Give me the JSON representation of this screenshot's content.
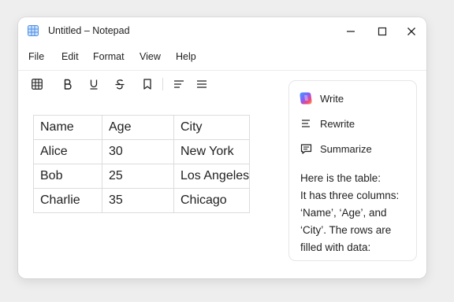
{
  "window": {
    "title": "Untitled – Notepad",
    "app_icon": "table-grid-icon",
    "controls": [
      "minimize-icon",
      "maximize-icon",
      "close-icon"
    ]
  },
  "menu": [
    "File",
    "Edit",
    "Format",
    "View",
    "Help"
  ],
  "toolbar": {
    "buttons": [
      "table-icon",
      "bold-icon",
      "underline-icon",
      "strikethrough-icon",
      "bookmark-icon",
      "align-left-icon",
      "list-icon"
    ]
  },
  "table": {
    "rows": [
      [
        "Name",
        "Age",
        "City"
      ],
      [
        "Alice",
        "30",
        "New York"
      ],
      [
        "Bob",
        "25",
        "Los Angeles"
      ],
      [
        "Charlie",
        "35",
        "Chicago"
      ]
    ]
  },
  "ai_panel": {
    "actions": [
      {
        "label": "Write",
        "icon": "copilot-icon"
      },
      {
        "label": "Rewrite",
        "icon": "rewrite-lines-icon"
      },
      {
        "label": "Summarize",
        "icon": "summarize-icon"
      }
    ],
    "response_lines": [
      "Here is the table:",
      "It has three columns:",
      "‘Name’, ‘Age’, and",
      "‘City’. The rows are",
      "filled with data:"
    ]
  },
  "colors": {
    "background": "#eeeeef",
    "window": "#ffffff",
    "text": "#1f1f1f",
    "border": "#dcdcdc",
    "app_icon": "#4a8fe7"
  }
}
